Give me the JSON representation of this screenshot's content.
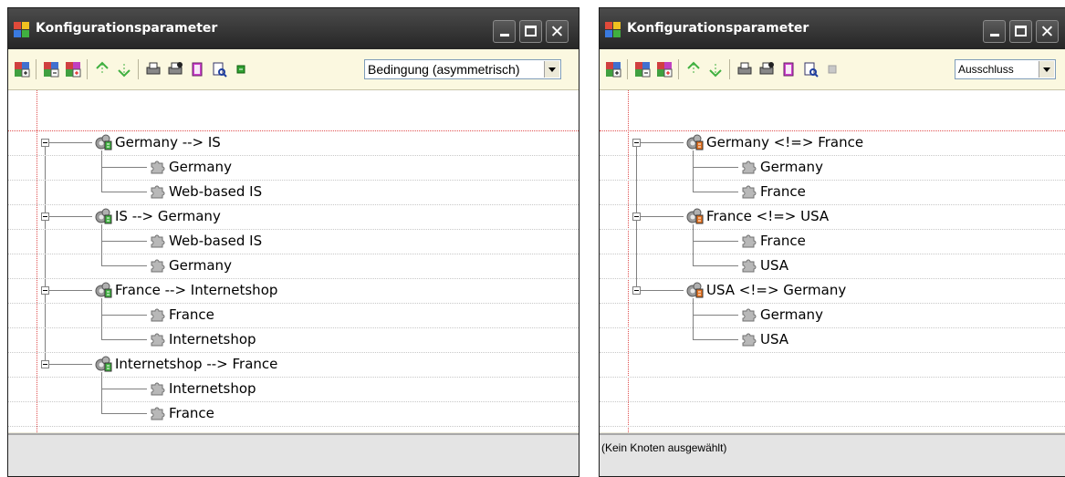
{
  "colors": {
    "title_bar": "#333333",
    "toolbar_bg": "#fbf8e0",
    "status_bg": "#e4e4e4",
    "guide_line": "#e05050"
  },
  "left_window": {
    "title": "Konfigurationsparameter",
    "controls": {
      "minimize": "minimize-icon",
      "maximize": "maximize-icon",
      "close": "close-icon"
    },
    "toolbar": {
      "icons": [
        "add-node-icon",
        "add-child-node-icon",
        "add-multi-node-icon",
        "move-up-icon",
        "move-down-icon",
        "print-icon",
        "print-preview-icon",
        "book-icon",
        "find-icon",
        "square-icon"
      ],
      "mode_select": "Bedingung (asymmetrisch)"
    },
    "tree": [
      {
        "label": "Germany --> IS",
        "children": [
          "Germany",
          "Web-based IS"
        ]
      },
      {
        "label": "IS --> Germany",
        "children": [
          "Web-based IS",
          "Germany"
        ]
      },
      {
        "label": "France --> Internetshop",
        "children": [
          "France",
          "Internetshop"
        ]
      },
      {
        "label": "Internetshop --> France",
        "children": [
          "Internetshop",
          "France"
        ]
      }
    ],
    "status": ""
  },
  "right_window": {
    "title": "Konfigurationsparameter",
    "controls": {
      "minimize": "minimize-icon",
      "maximize": "maximize-icon",
      "close": "close-icon"
    },
    "toolbar": {
      "icons": [
        "add-node-icon",
        "add-child-node-icon",
        "add-multi-node-icon",
        "move-up-icon",
        "move-down-icon",
        "print-icon",
        "print-preview-icon",
        "book-icon",
        "find-icon",
        "square-icon"
      ],
      "mode_select": "Ausschluss"
    },
    "tree": [
      {
        "label": "Germany <!=> France",
        "children": [
          "Germany",
          "France"
        ]
      },
      {
        "label": "France <!=> USA",
        "children": [
          "France",
          "USA"
        ]
      },
      {
        "label": "USA <!=> Germany",
        "children": [
          "Germany",
          "USA"
        ]
      }
    ],
    "status": "(Kein Knoten ausgewählt)"
  }
}
